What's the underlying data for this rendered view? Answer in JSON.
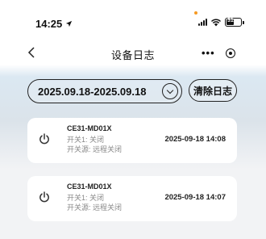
{
  "status_bar": {
    "time": "14:25",
    "battery": "31"
  },
  "nav": {
    "title": "设备日志",
    "more": "•••"
  },
  "filter": {
    "date_range": "2025.09.18-2025.09.18",
    "clear_label": "清除日志"
  },
  "logs": [
    {
      "device": "CE31-MD01X",
      "switch_line": "开关1: 关闭",
      "source_line": "开关源: 远程关闭",
      "time": "2025-09-18 14:08"
    },
    {
      "device": "CE31-MD01X",
      "switch_line": "开关1: 关闭",
      "source_line": "开关源: 远程关闭",
      "time": "2025-09-18 14:07"
    }
  ],
  "colors": {
    "accent_orange": "#f59a23",
    "header_blue": "#dbe8f2",
    "card_bg": "#ffffff"
  }
}
